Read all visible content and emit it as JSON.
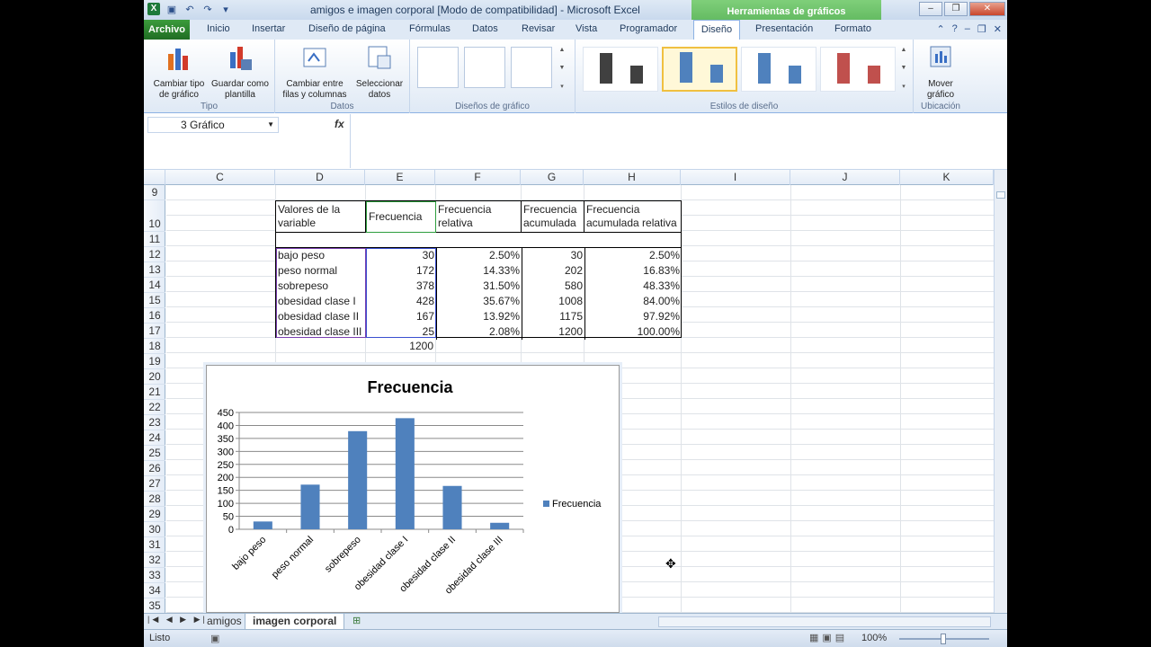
{
  "titlebar": {
    "title": "amigos e imagen corporal  [Modo de compatibilidad]  -  Microsoft Excel",
    "context_tab": "Herramientas de gráficos"
  },
  "ribbon_tabs": [
    "Archivo",
    "Inicio",
    "Insertar",
    "Diseño de página",
    "Fórmulas",
    "Datos",
    "Revisar",
    "Vista",
    "Programador",
    "Diseño",
    "Presentación",
    "Formato"
  ],
  "ribbon": {
    "tipo": {
      "label": "Tipo",
      "change_type": "Cambiar tipo\nde gráfico",
      "save_template": "Guardar como\nplantilla"
    },
    "datos": {
      "label": "Datos",
      "switch_rows": "Cambiar entre\nfilas y columnas",
      "select_data": "Seleccionar\ndatos"
    },
    "disenos_label": "Diseños de gráfico",
    "estilos_label": "Estilos de diseño",
    "ubicacion": {
      "label": "Ubicación",
      "move_chart": "Mover\ngráfico"
    }
  },
  "formula_bar": {
    "name_box": "3 Gráfico",
    "fx": "fx",
    "formula": ""
  },
  "columns": [
    "C",
    "D",
    "E",
    "F",
    "G",
    "H",
    "I",
    "J",
    "K"
  ],
  "rows": [
    "9",
    "10",
    "11",
    "12",
    "13",
    "14",
    "15",
    "16",
    "17",
    "18",
    "19",
    "20",
    "21",
    "22",
    "23",
    "24",
    "25",
    "26",
    "27",
    "28",
    "29",
    "30",
    "31",
    "32",
    "33",
    "34",
    "35"
  ],
  "table": {
    "headers": [
      "Valores de la\nvariable",
      "Frecuencia",
      "Frecuencia\nrelativa",
      "Frecuencia\nacumulada",
      "Frecuencia\nacumulada relativa"
    ],
    "rows": [
      [
        "bajo peso",
        "30",
        "2.50%",
        "30",
        "2.50%"
      ],
      [
        "peso normal",
        "172",
        "14.33%",
        "202",
        "16.83%"
      ],
      [
        "sobrepeso",
        "378",
        "31.50%",
        "580",
        "48.33%"
      ],
      [
        "obesidad clase I",
        "428",
        "35.67%",
        "1008",
        "84.00%"
      ],
      [
        "obesidad clase II",
        "167",
        "13.92%",
        "1175",
        "97.92%"
      ],
      [
        "obesidad clase III",
        "25",
        "2.08%",
        "1200",
        "100.00%"
      ]
    ],
    "total": "1200"
  },
  "chart_data": {
    "type": "bar",
    "title": "Frecuencia",
    "categories": [
      "bajo peso",
      "peso normal",
      "sobrepeso",
      "obesidad clase I",
      "obesidad clase II",
      "obesidad clase III"
    ],
    "series": [
      {
        "name": "Frecuencia",
        "values": [
          30,
          172,
          378,
          428,
          167,
          25
        ],
        "color": "#4f81bd"
      }
    ],
    "ylim": [
      0,
      450
    ],
    "yticks": [
      0,
      50,
      100,
      150,
      200,
      250,
      300,
      350,
      400,
      450
    ],
    "legend": "right",
    "grid": true
  },
  "sheets": [
    "amigos",
    "imagen corporal"
  ],
  "status": {
    "text": "Listo",
    "zoom": "100%"
  }
}
